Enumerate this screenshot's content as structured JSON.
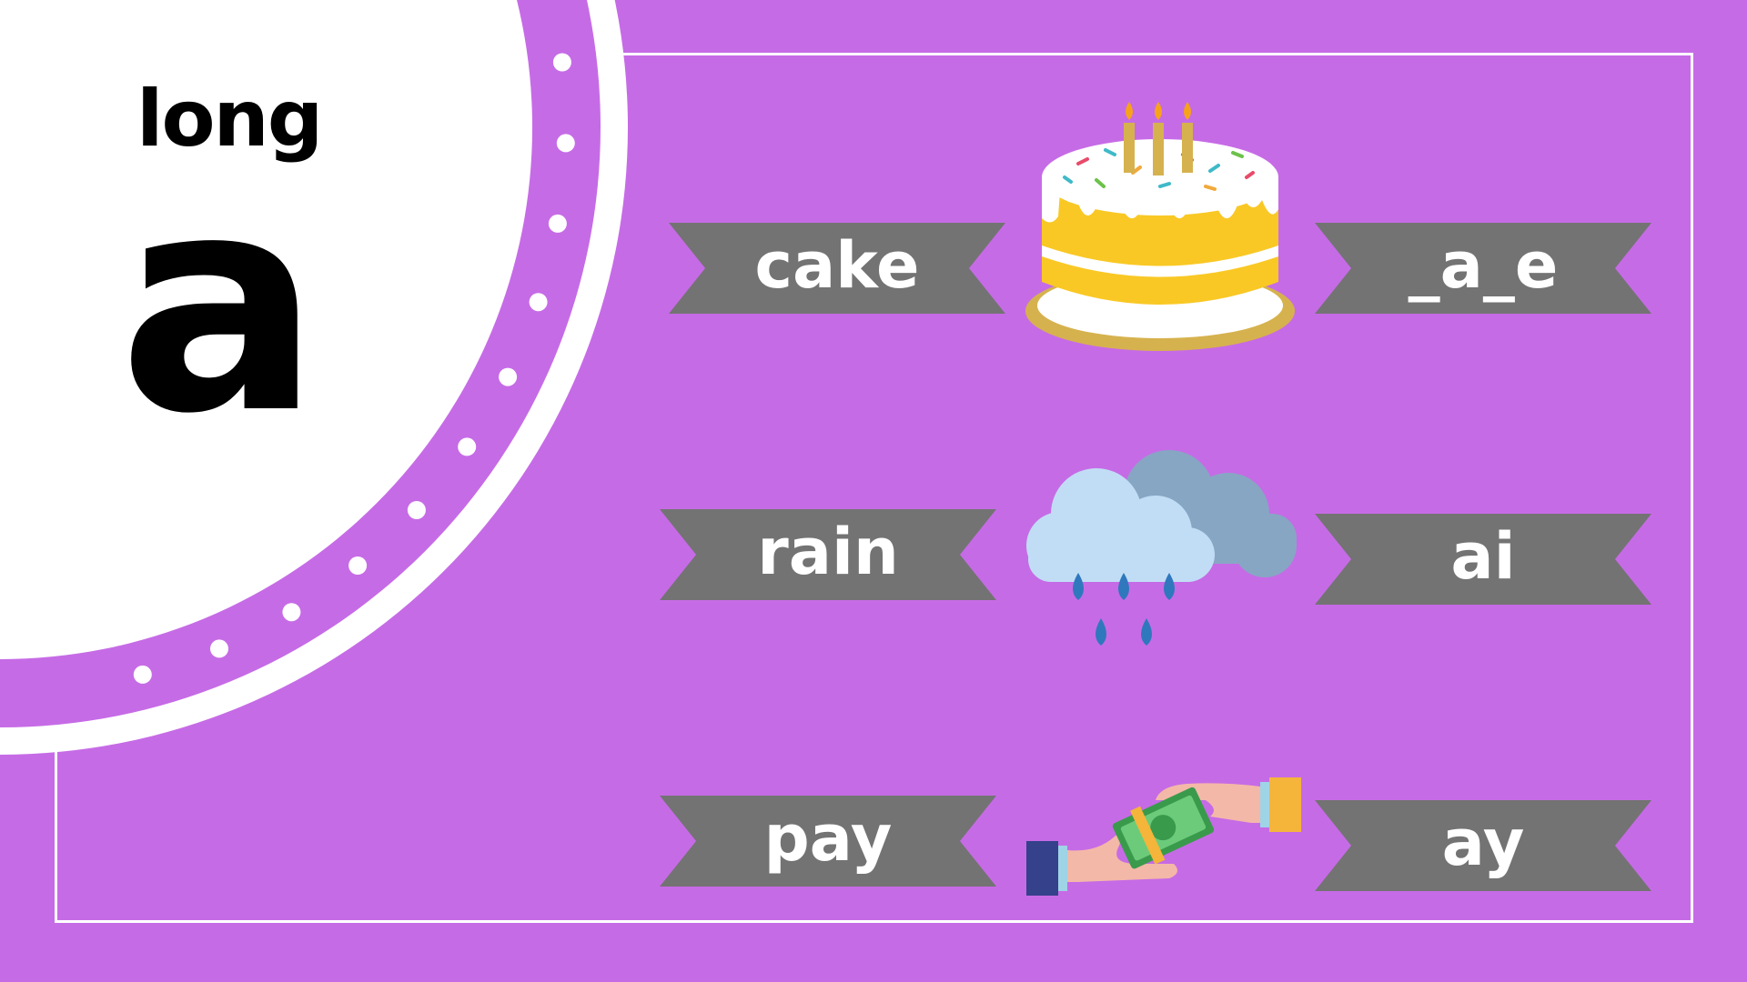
{
  "heading": {
    "long": "long",
    "letter": "a"
  },
  "rows": [
    {
      "word": "cake",
      "spelling": "_a_e",
      "picture": "cake-icon"
    },
    {
      "word": "rain",
      "spelling": "ai",
      "picture": "rain-cloud-icon"
    },
    {
      "word": "pay",
      "spelling": "ay",
      "picture": "money-exchange-icon"
    }
  ],
  "colors": {
    "background": "#c66be6",
    "ribbon": "#737373",
    "text": "#ffffff",
    "circle": "#ffffff"
  }
}
